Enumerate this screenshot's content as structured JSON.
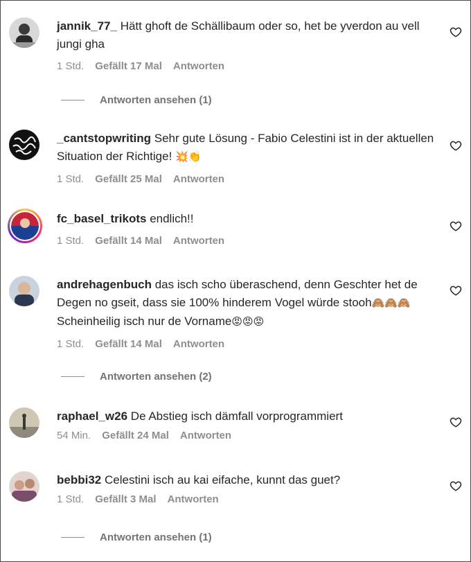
{
  "comments": [
    {
      "username": "jannik_77_",
      "text": "Hätt ghoft de Schällibaum oder so, het be yverdon au vell jungi gha",
      "time": "1 Std.",
      "likes": "Gefällt 17 Mal",
      "reply": "Antworten",
      "view_replies": "Antworten ansehen (1)"
    },
    {
      "username": "_cantstopwriting",
      "text": "Sehr gute Lösung - Fabio Celestini ist in der aktuellen Situation der Richtige!",
      "emoji": "💥👏",
      "time": "1 Std.",
      "likes": "Gefällt 25 Mal",
      "reply": "Antworten"
    },
    {
      "username": "fc_basel_trikots",
      "text": "endlich!!",
      "time": "1 Std.",
      "likes": "Gefällt 14 Mal",
      "reply": "Antworten"
    },
    {
      "username": "andrehagenbuch",
      "text": "das isch scho überaschend, denn Geschter het de Degen no gseit, dass sie 100% hinderem Vogel würde stooh",
      "emoji_mid": "🙈🙈🙈",
      "text2": "Scheinheilig isch nur de Vorname",
      "emoji": "😡😡😡",
      "time": "1 Std.",
      "likes": "Gefällt 14 Mal",
      "reply": "Antworten",
      "view_replies": "Antworten ansehen (2)"
    },
    {
      "username": "raphael_w26",
      "text": "De Abstieg isch dämfall vorprogrammiert",
      "time": "54 Min.",
      "likes": "Gefällt 24 Mal",
      "reply": "Antworten"
    },
    {
      "username": "bebbi32",
      "text": "Celestini isch au kai eifache, kunnt das guet?",
      "time": "1 Std.",
      "likes": "Gefällt 3 Mal",
      "reply": "Antworten",
      "view_replies": "Antworten ansehen (1)"
    }
  ],
  "icons": {
    "like": "heart-outline-icon"
  }
}
